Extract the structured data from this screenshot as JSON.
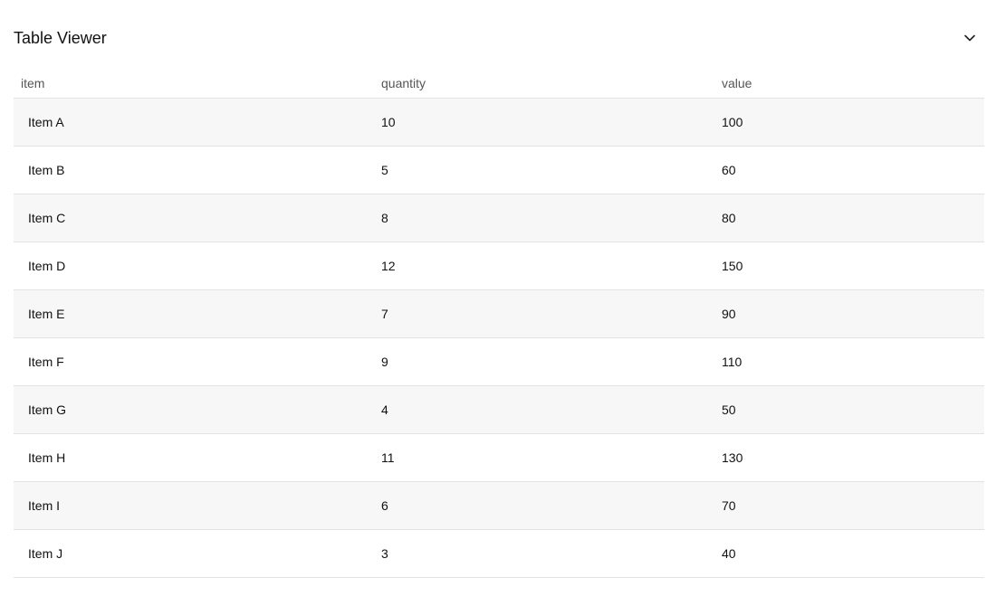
{
  "viewer": {
    "title": "Table Viewer",
    "toggle_icon": "chevron-down-icon"
  },
  "table": {
    "columns": [
      "item",
      "quantity",
      "value"
    ],
    "rows": [
      [
        "Item A",
        "10",
        "100"
      ],
      [
        "Item B",
        "5",
        "60"
      ],
      [
        "Item C",
        "8",
        "80"
      ],
      [
        "Item D",
        "12",
        "150"
      ],
      [
        "Item E",
        "7",
        "90"
      ],
      [
        "Item F",
        "9",
        "110"
      ],
      [
        "Item G",
        "4",
        "50"
      ],
      [
        "Item H",
        "11",
        "130"
      ],
      [
        "Item I",
        "6",
        "70"
      ],
      [
        "Item J",
        "3",
        "40"
      ]
    ]
  }
}
